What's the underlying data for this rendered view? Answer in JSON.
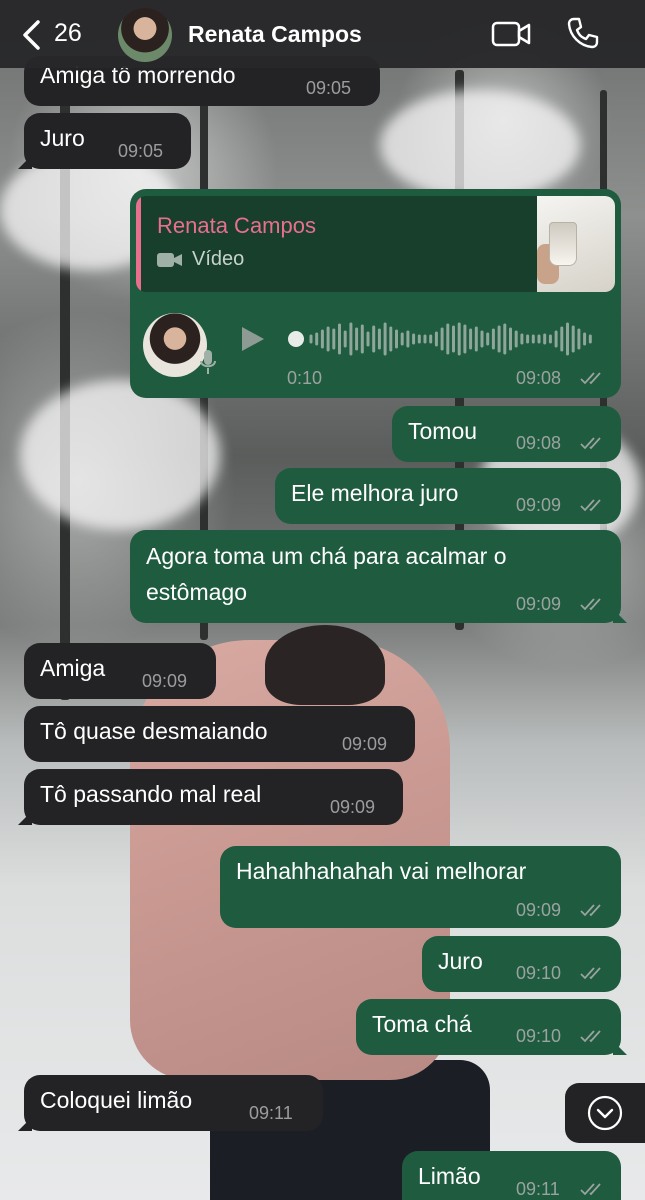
{
  "header": {
    "back_count": "26",
    "contact_name": "Renata Campos"
  },
  "colors": {
    "header_bg": "#28282a",
    "incoming_bubble": "#232325",
    "outgoing_bubble": "#1e5b3f",
    "quote_accent": "#e86f8e",
    "timestamp": "#9aa39f"
  },
  "messages": [
    {
      "dir": "in",
      "text": "Amiga tô morrendo",
      "time": "09:05"
    },
    {
      "dir": "in",
      "text": "Juro",
      "time": "09:05"
    },
    {
      "dir": "out",
      "type": "voice_reply",
      "quote_author": "Renata Campos",
      "quote_type": "Vídeo",
      "duration": "0:10",
      "time": "09:08"
    },
    {
      "dir": "out",
      "text": "Tomou",
      "time": "09:08"
    },
    {
      "dir": "out",
      "text": "Ele melhora juro",
      "time": "09:09"
    },
    {
      "dir": "out",
      "text_line1": "Agora toma um chá para acalmar o",
      "text_line2": "estômago",
      "time": "09:09"
    },
    {
      "dir": "in",
      "text": "Amiga",
      "time": "09:09"
    },
    {
      "dir": "in",
      "text": "Tô quase desmaiando",
      "time": "09:09"
    },
    {
      "dir": "in",
      "text": "Tô passando mal real",
      "time": "09:09"
    },
    {
      "dir": "out",
      "text": "Hahahhahahah vai melhorar",
      "time": "09:09"
    },
    {
      "dir": "out",
      "text": "Juro",
      "time": "09:10"
    },
    {
      "dir": "out",
      "text": "Toma chá",
      "time": "09:10"
    },
    {
      "dir": "in",
      "text": "Coloquei limão",
      "time": "09:11"
    },
    {
      "dir": "out",
      "text": "Limão",
      "time": "09:11"
    }
  ],
  "icons": {
    "back": "chevron-left-icon",
    "video": "video-camera-icon",
    "call": "phone-icon",
    "read": "double-check-icon",
    "scroll": "chevron-down-icon"
  }
}
